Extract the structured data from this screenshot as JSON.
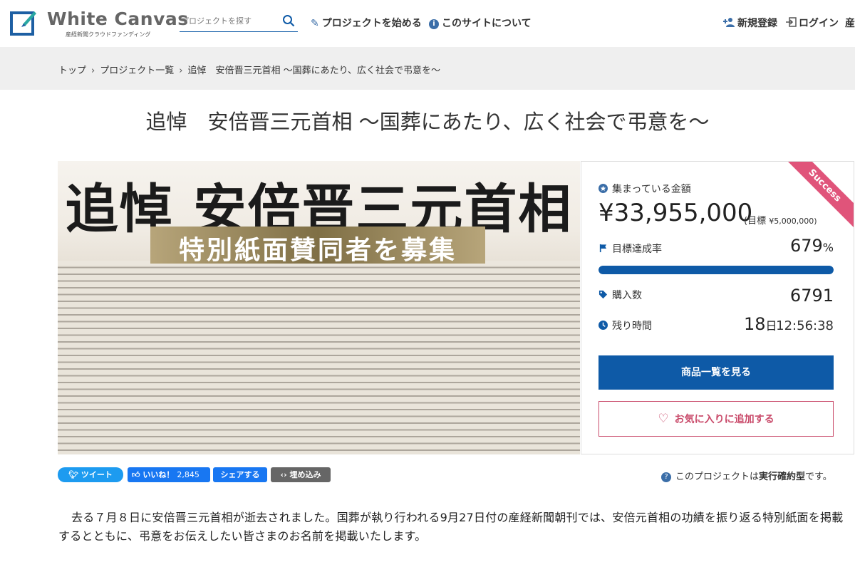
{
  "header": {
    "logo_title": "White Canvas",
    "logo_subtitle": "産経新聞クラウドファンディング",
    "search_placeholder": "プロジェクトを探す",
    "nav_start": "プロジェクトを始める",
    "nav_about": "このサイトについて",
    "nav_register": "新規登録",
    "nav_login": "ログイン",
    "nav_cut": "産"
  },
  "breadcrumb": [
    "トップ",
    "プロジェクト一覧",
    "追悼　安倍晋三元首相 ～国葬にあたり、広く社会で弔意を～"
  ],
  "page_title": "追悼　安倍晋三元首相 ～国葬にあたり、広く社会で弔意を～",
  "hero": {
    "heading": "追悼 安倍晋三元首相",
    "subheading": "特別紙面賛同者を募集"
  },
  "panel": {
    "ribbon": "Success",
    "amount_label": "集まっている金額",
    "amount": "¥33,955,000",
    "goal_prefix": "(目標",
    "goal_value": "¥5,000,000)",
    "rate_label": "目標達成率",
    "rate_value": "679",
    "rate_unit": "%",
    "rate_fraction": 1.0,
    "buyers_label": "購入数",
    "buyers_value": "6791",
    "time_label": "残り時間",
    "time_days": "18",
    "time_days_unit": "日",
    "time_clock": "12:56:38",
    "btn_list": "商品一覧を見る",
    "btn_fav": "お気に入りに追加する"
  },
  "social": {
    "tweet": "ツイート",
    "like": "いいね！",
    "like_count": "2,845",
    "share": "シェアする",
    "embed": "埋め込み"
  },
  "project_type": {
    "prefix": "このプロジェクトは",
    "type": "実行確約型",
    "suffix": "です。"
  },
  "body_text": "去る７月８日に安倍晋三元首相が逝去されました。国葬が執り行われる9月27日付の産経新聞朝刊では、安倍元首相の功績を振り返る特別紙面を掲載するとともに、弔意をお伝えしたい皆さまのお名前を掲載いたします。",
  "colors": {
    "brand_blue": "#0e5aa7",
    "success_ribbon": "#e0547a",
    "fav_pink": "#c94a6a"
  }
}
